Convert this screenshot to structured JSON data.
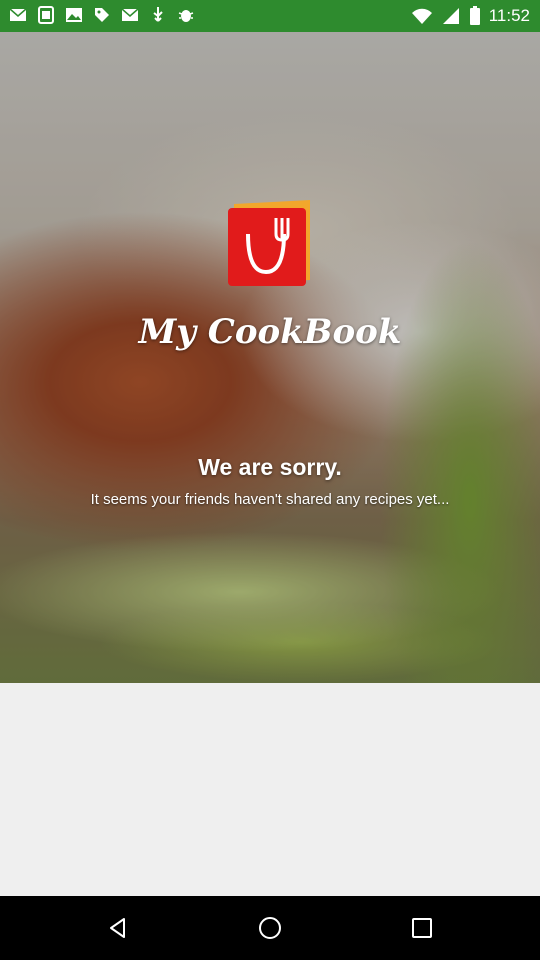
{
  "status_bar": {
    "time": "11:52",
    "icons": [
      "mail-icon",
      "screenshot-icon",
      "image-icon",
      "tag-icon",
      "mail-icon",
      "usb-icon",
      "bug-icon",
      "wifi-icon",
      "signal-icon",
      "battery-icon"
    ]
  },
  "app": {
    "title": "My CookBook",
    "brand_color": "#e11b1b"
  },
  "empty_state": {
    "title": "We are sorry.",
    "message": "It seems your friends haven't shared any recipes yet..."
  },
  "nav": {
    "back": "back-icon",
    "home": "home-icon",
    "recent": "recent-apps-icon"
  }
}
